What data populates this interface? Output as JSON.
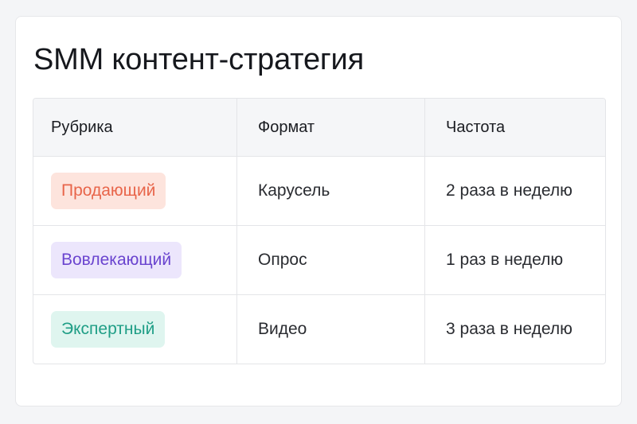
{
  "title": "SMM контент-стратегия",
  "columns": [
    "Рубрика",
    "Формат",
    "Частота"
  ],
  "rows": [
    {
      "rubric": "Продающий",
      "format": "Карусель",
      "frequency": "2 раза в неделю",
      "badge_text_color": "#e8654a",
      "badge_bg_color": "#fde4dd"
    },
    {
      "rubric": "Вовлекающий",
      "format": "Опрос",
      "frequency": "1 раз в неделю",
      "badge_text_color": "#6a44cf",
      "badge_bg_color": "#ece6fc"
    },
    {
      "rubric": "Экспертный",
      "format": "Видео",
      "frequency": "3 раза в неделю",
      "badge_text_color": "#1f9e86",
      "badge_bg_color": "#dff5ef"
    }
  ]
}
